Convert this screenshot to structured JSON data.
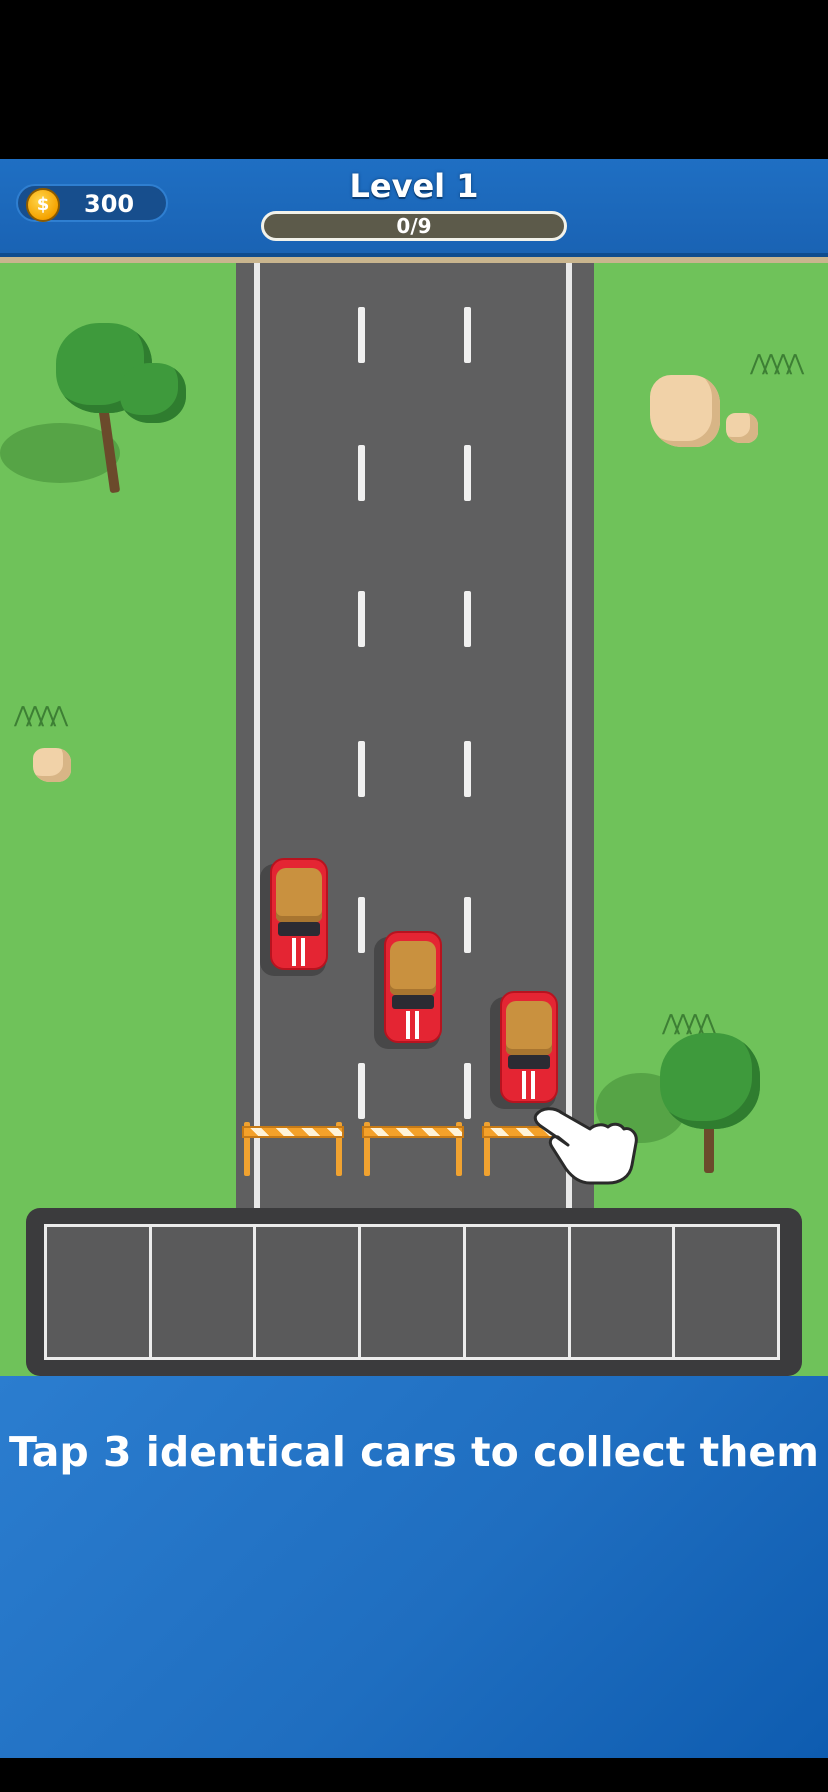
{
  "hud": {
    "coins": "300",
    "coin_symbol": "$",
    "level_title": "Level 1",
    "progress_text": "0/9",
    "progress_value": 0,
    "progress_total": 9
  },
  "scene": {
    "cars": [
      {
        "color": "red",
        "roof_color": "tan"
      },
      {
        "color": "red",
        "roof_color": "tan"
      },
      {
        "color": "red",
        "roof_color": "tan"
      }
    ],
    "barrier_count": 3,
    "icons": [
      "tree-icon",
      "rock-icon",
      "grass-icon",
      "tap-hand-icon",
      "coin-icon"
    ]
  },
  "slots": {
    "count": 7
  },
  "instruction": {
    "text": "Tap 3 identical cars to collect them"
  },
  "colors": {
    "hud_blue": "#1f6fc3",
    "grass": "#6fc25a",
    "road": "#5f5f60",
    "car_red": "#e42533",
    "panel_blue": "#1f6ec0"
  }
}
